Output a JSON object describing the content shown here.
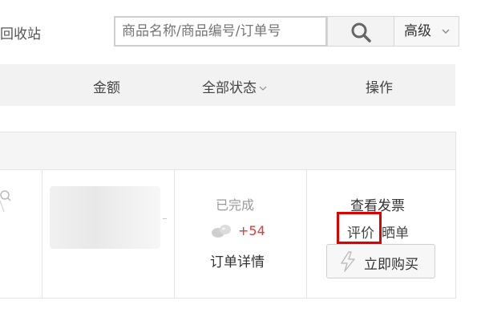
{
  "topbar": {
    "recycle_label": "回收站",
    "search_placeholder": "商品名称/商品编号/订单号",
    "advanced_label": "高级"
  },
  "table_header": {
    "amount": "金额",
    "status": "全部状态",
    "action": "操作"
  },
  "order": {
    "status": "已完成",
    "beans": "+54",
    "detail_link": "订单详情",
    "invoice_link": "查看发票",
    "review_link": "评价",
    "share_link": "晒单",
    "buy_again": "立即购买"
  },
  "colors": {
    "highlight": "#e00000",
    "beans": "#e4393c"
  }
}
